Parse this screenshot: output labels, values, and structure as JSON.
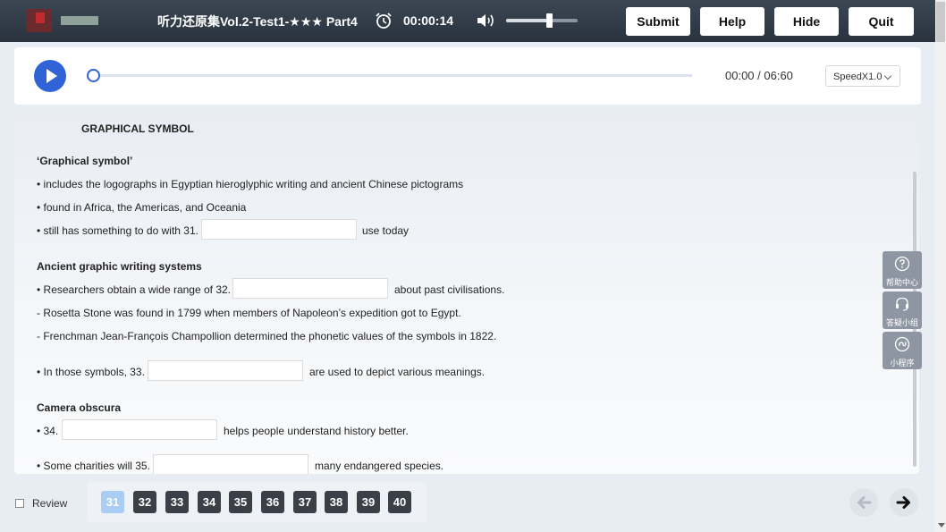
{
  "header": {
    "title": "听力还原集Vol.2-Test1-★★★ Part4",
    "timer": "00:00:14",
    "volume_level": 0.6,
    "buttons": {
      "submit": "Submit",
      "help": "Help",
      "hide": "Hide",
      "quit": "Quit"
    }
  },
  "player": {
    "time": "00:00 / 06:60",
    "progress": 0.0,
    "speed": "SpeedX1.0"
  },
  "content": {
    "section_title": "GRAPHICAL SYMBOL",
    "heading1": "‘Graphical symbol’",
    "l1": "• includes the logographs in Egyptian hieroglyphic writing and ancient Chinese pictograms",
    "l2": "• found in Africa, the Americas, and Oceania",
    "l3a": "• still has something to do with 31.",
    "l3b": "use today",
    "heading2": "Ancient graphic writing systems",
    "l4a": "• Researchers obtain a wide range of 32.",
    "l4b": "about past civilisations.",
    "l5": "- Rosetta Stone was found in 1799 when members of Napoleon’s expedition got to Egypt.",
    "l6": "- Frenchman Jean-François Champollion determined the phonetic values of the symbols in 1822.",
    "l7a": "• In those symbols, 33.",
    "l7b": "are used to depict various meanings.",
    "heading3": "Camera obscura",
    "l8a": "• 34.",
    "l8b": "helps people understand history better.",
    "l9a": "• Some charities will 35.",
    "l9b": "many endangered species.",
    "answers": {
      "a31": "",
      "a32": "",
      "a33": "",
      "a34": "",
      "a35": ""
    }
  },
  "side": {
    "help_center": "帮助中心",
    "qa_group": "答疑小组",
    "mini_program": "小程序"
  },
  "footer": {
    "review": "Review",
    "questions": [
      "31",
      "32",
      "33",
      "34",
      "35",
      "36",
      "37",
      "38",
      "39",
      "40"
    ],
    "active_question": "31"
  }
}
